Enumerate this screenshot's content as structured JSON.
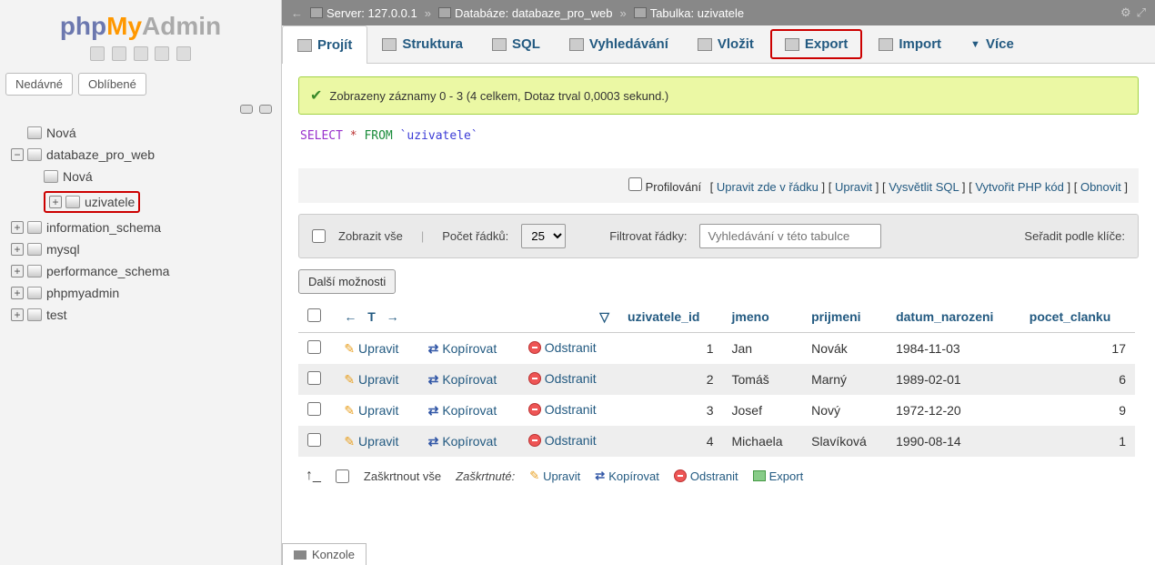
{
  "logo": {
    "php": "php",
    "my": "My",
    "admin": "Admin"
  },
  "sidebar": {
    "tabs": {
      "recent": "Nedávné",
      "favorites": "Oblíbené"
    },
    "items": [
      {
        "label": "Nová",
        "type": "new"
      },
      {
        "label": "databaze_pro_web",
        "type": "db",
        "open": true,
        "children": [
          {
            "label": "Nová",
            "type": "new"
          },
          {
            "label": "uzivatele",
            "type": "table",
            "highlight": true
          }
        ]
      },
      {
        "label": "information_schema",
        "type": "db"
      },
      {
        "label": "mysql",
        "type": "db"
      },
      {
        "label": "performance_schema",
        "type": "db"
      },
      {
        "label": "phpmyadmin",
        "type": "db"
      },
      {
        "label": "test",
        "type": "db"
      }
    ]
  },
  "breadcrumb": {
    "server_label": "Server:",
    "server": "127.0.0.1",
    "db_label": "Databáze:",
    "db": "databaze_pro_web",
    "table_label": "Tabulka:",
    "table": "uzivatele"
  },
  "tabs": {
    "browse": "Projít",
    "structure": "Struktura",
    "sql": "SQL",
    "search": "Vyhledávání",
    "insert": "Vložit",
    "export": "Export",
    "import": "Import",
    "more": "Více"
  },
  "notice": "Zobrazeny záznamy 0 - 3 (4 celkem, Dotaz trval 0,0003 sekund.)",
  "sql": {
    "select": "SELECT",
    "star": "*",
    "from": "FROM",
    "table": "`uzivatele`"
  },
  "sqllinks": {
    "profiling": "Profilování",
    "inline": "Upravit zde v řádku",
    "edit": "Upravit",
    "explain": "Vysvětlit SQL",
    "php": "Vytvořit PHP kód",
    "refresh": "Obnovit"
  },
  "filterbar": {
    "showall": "Zobrazit vše",
    "rowslabel": "Počet řádků:",
    "rows": "25",
    "filterlabel": "Filtrovat řádky:",
    "placeholder": "Vyhledávání v této tabulce",
    "sortlabel": "Seřadit podle klíče:"
  },
  "more_options": "Další možnosti",
  "columns": {
    "id": "uzivatele_id",
    "jmeno": "jmeno",
    "prijmeni": "prijmeni",
    "datum": "datum_narozeni",
    "pocet": "pocet_clanku"
  },
  "actions": {
    "edit": "Upravit",
    "copy": "Kopírovat",
    "delete": "Odstranit",
    "export": "Export"
  },
  "rows": [
    {
      "id": 1,
      "jmeno": "Jan",
      "prijmeni": "Novák",
      "datum": "1984-11-03",
      "pocet": 17
    },
    {
      "id": 2,
      "jmeno": "Tomáš",
      "prijmeni": "Marný",
      "datum": "1989-02-01",
      "pocet": 6
    },
    {
      "id": 3,
      "jmeno": "Josef",
      "prijmeni": "Nový",
      "datum": "1972-12-20",
      "pocet": 9
    },
    {
      "id": 4,
      "jmeno": "Michaela",
      "prijmeni": "Slavíková",
      "datum": "1990-08-14",
      "pocet": 1
    }
  ],
  "footer": {
    "checkall": "Zaškrtnout vše",
    "withsel": "Zaškrtnuté:"
  },
  "console": "Konzole"
}
